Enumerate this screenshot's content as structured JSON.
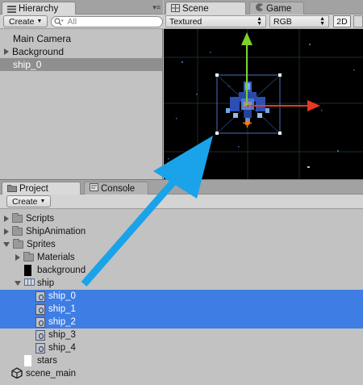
{
  "hierarchy": {
    "tab_label": "Hierarchy",
    "create_label": "Create",
    "search_placeholder": "All",
    "items": [
      {
        "label": "Main Camera",
        "expandable": false,
        "selected": false
      },
      {
        "label": "Background",
        "expandable": true,
        "selected": false
      },
      {
        "label": "ship_0",
        "expandable": false,
        "selected": true
      }
    ]
  },
  "scene": {
    "tabs": [
      {
        "label": "Scene",
        "active": true
      },
      {
        "label": "Game",
        "active": false
      }
    ],
    "shading_mode": "Textured",
    "color_mode": "RGB",
    "mode_2d": "2D"
  },
  "project": {
    "tabs": [
      {
        "label": "Project",
        "active": true
      },
      {
        "label": "Console",
        "active": false
      }
    ],
    "create_label": "Create",
    "items": [
      {
        "label": "Scripts",
        "kind": "folder",
        "indent": 0,
        "expand": "collapsed",
        "selected": false
      },
      {
        "label": "ShipAnimation",
        "kind": "folder",
        "indent": 0,
        "expand": "collapsed",
        "selected": false
      },
      {
        "label": "Sprites",
        "kind": "folder",
        "indent": 0,
        "expand": "expanded",
        "selected": false
      },
      {
        "label": "Materials",
        "kind": "folder",
        "indent": 1,
        "expand": "collapsed",
        "selected": false
      },
      {
        "label": "background",
        "kind": "black-texture",
        "indent": 1,
        "expand": "none",
        "selected": false
      },
      {
        "label": "ship",
        "kind": "sprite-sheet",
        "indent": 1,
        "expand": "expanded",
        "selected": false
      },
      {
        "label": "ship_0",
        "kind": "sprite",
        "indent": 2,
        "expand": "none",
        "selected": true
      },
      {
        "label": "ship_1",
        "kind": "sprite",
        "indent": 2,
        "expand": "none",
        "selected": true
      },
      {
        "label": "ship_2",
        "kind": "sprite",
        "indent": 2,
        "expand": "none",
        "selected": true
      },
      {
        "label": "ship_3",
        "kind": "sprite",
        "indent": 2,
        "expand": "none",
        "selected": false
      },
      {
        "label": "ship_4",
        "kind": "sprite",
        "indent": 2,
        "expand": "none",
        "selected": false
      },
      {
        "label": "stars",
        "kind": "white-texture",
        "indent": 1,
        "expand": "none",
        "selected": false
      },
      {
        "label": "scene_main",
        "kind": "unity-scene",
        "indent": 0,
        "expand": "none",
        "selected": false
      }
    ]
  },
  "colors": {
    "selection_blue": "#3e7de4",
    "hierarchy_selection": "#8f8f8f",
    "annotation_arrow": "#1aa3e8",
    "gizmo_x": "#e83a1e",
    "gizmo_y": "#7cd12a"
  }
}
